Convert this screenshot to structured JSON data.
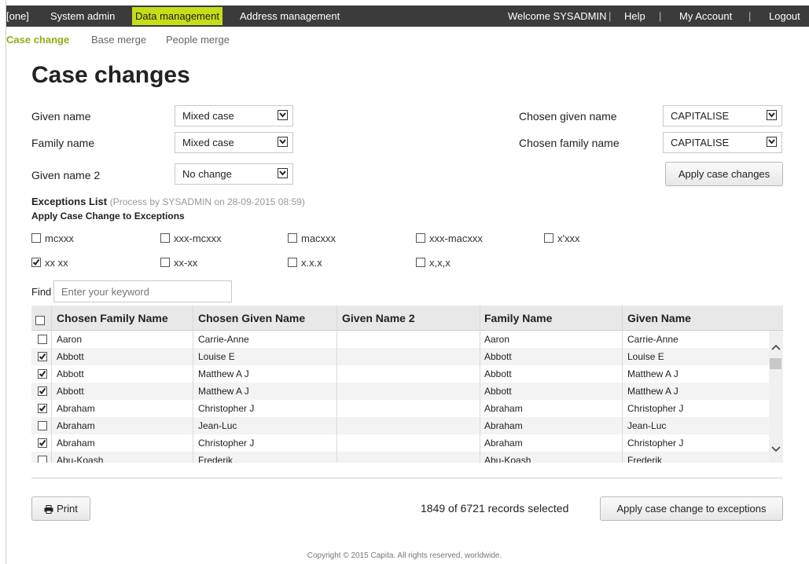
{
  "topbar": {
    "brand": "[one]",
    "nav": [
      "System admin",
      "Data management",
      "Address management"
    ],
    "welcome": "Welcome SYSADMIN",
    "help": "Help",
    "account": "My Account",
    "logout": "Logout",
    "separator": "|"
  },
  "subnav": [
    "Case change",
    "Base merge",
    "People merge"
  ],
  "page_title": "Case changes",
  "fields": {
    "given_name": {
      "label": "Given name",
      "value": "Mixed case"
    },
    "family_name": {
      "label": "Family name",
      "value": "Mixed case"
    },
    "given_name_2": {
      "label": "Given name 2",
      "value": "No change"
    },
    "chosen_given_name": {
      "label": "Chosen given name",
      "value": "CAPITALISE"
    },
    "chosen_family_name": {
      "label": "Chosen family name",
      "value": "CAPITALISE"
    }
  },
  "apply_case_changes": "Apply case changes",
  "exceptions": {
    "title": "Exceptions List",
    "meta": "(Process by SYSADMIN on 28-09-2015 08:59)",
    "subtitle": "Apply Case Change to Exceptions",
    "options": [
      {
        "label": "mcxxx",
        "checked": false
      },
      {
        "label": "xxx-mcxxx",
        "checked": false
      },
      {
        "label": "macxxx",
        "checked": false
      },
      {
        "label": "xxx-macxxx",
        "checked": false
      },
      {
        "label": "x'xxx",
        "checked": false
      },
      {
        "label": "xx xx",
        "checked": true
      },
      {
        "label": "xx-xx",
        "checked": false
      },
      {
        "label": "x.x.x",
        "checked": false
      },
      {
        "label": "x,x,x",
        "checked": false
      }
    ]
  },
  "find": {
    "label": "Find",
    "placeholder": "Enter your keyword"
  },
  "table": {
    "columns": [
      "Chosen Family Name",
      "Chosen Given Name",
      "Given Name 2",
      "Family Name",
      "Given Name"
    ],
    "rows": [
      {
        "checked": false,
        "cells": [
          "Aaron",
          "Carrie-Anne",
          "",
          "Aaron",
          "Carrie-Anne"
        ]
      },
      {
        "checked": true,
        "cells": [
          "Abbott",
          "Louise E",
          "",
          "Abbott",
          "Louise E"
        ]
      },
      {
        "checked": true,
        "cells": [
          "Abbott",
          "Matthew A J",
          "",
          "Abbott",
          "Matthew A J"
        ]
      },
      {
        "checked": true,
        "cells": [
          "Abbott",
          "Matthew A J",
          "",
          "Abbott",
          "Matthew A J"
        ]
      },
      {
        "checked": true,
        "cells": [
          "Abraham",
          "Christopher J",
          "",
          "Abraham",
          "Christopher J"
        ]
      },
      {
        "checked": false,
        "cells": [
          "Abraham",
          "Jean-Luc",
          "",
          "Abraham",
          "Jean-Luc"
        ]
      },
      {
        "checked": true,
        "cells": [
          "Abraham",
          "Christopher J",
          "",
          "Abraham",
          "Christopher J"
        ]
      },
      {
        "checked": false,
        "cells": [
          "Abu-Koash",
          "Frederik",
          "",
          "Abu-Koash",
          "Frederik"
        ]
      }
    ]
  },
  "print_label": "Print",
  "records_text": "1849 of 6721 records selected",
  "apply_exceptions": "Apply case change to exceptions",
  "footer": "Copyright © 2015 Capita. All rights reserved, worldwide.",
  "colors": {
    "accent": "#c6de1a",
    "topbar": "#3b3b3b",
    "active_subnav": "#8fae16"
  }
}
